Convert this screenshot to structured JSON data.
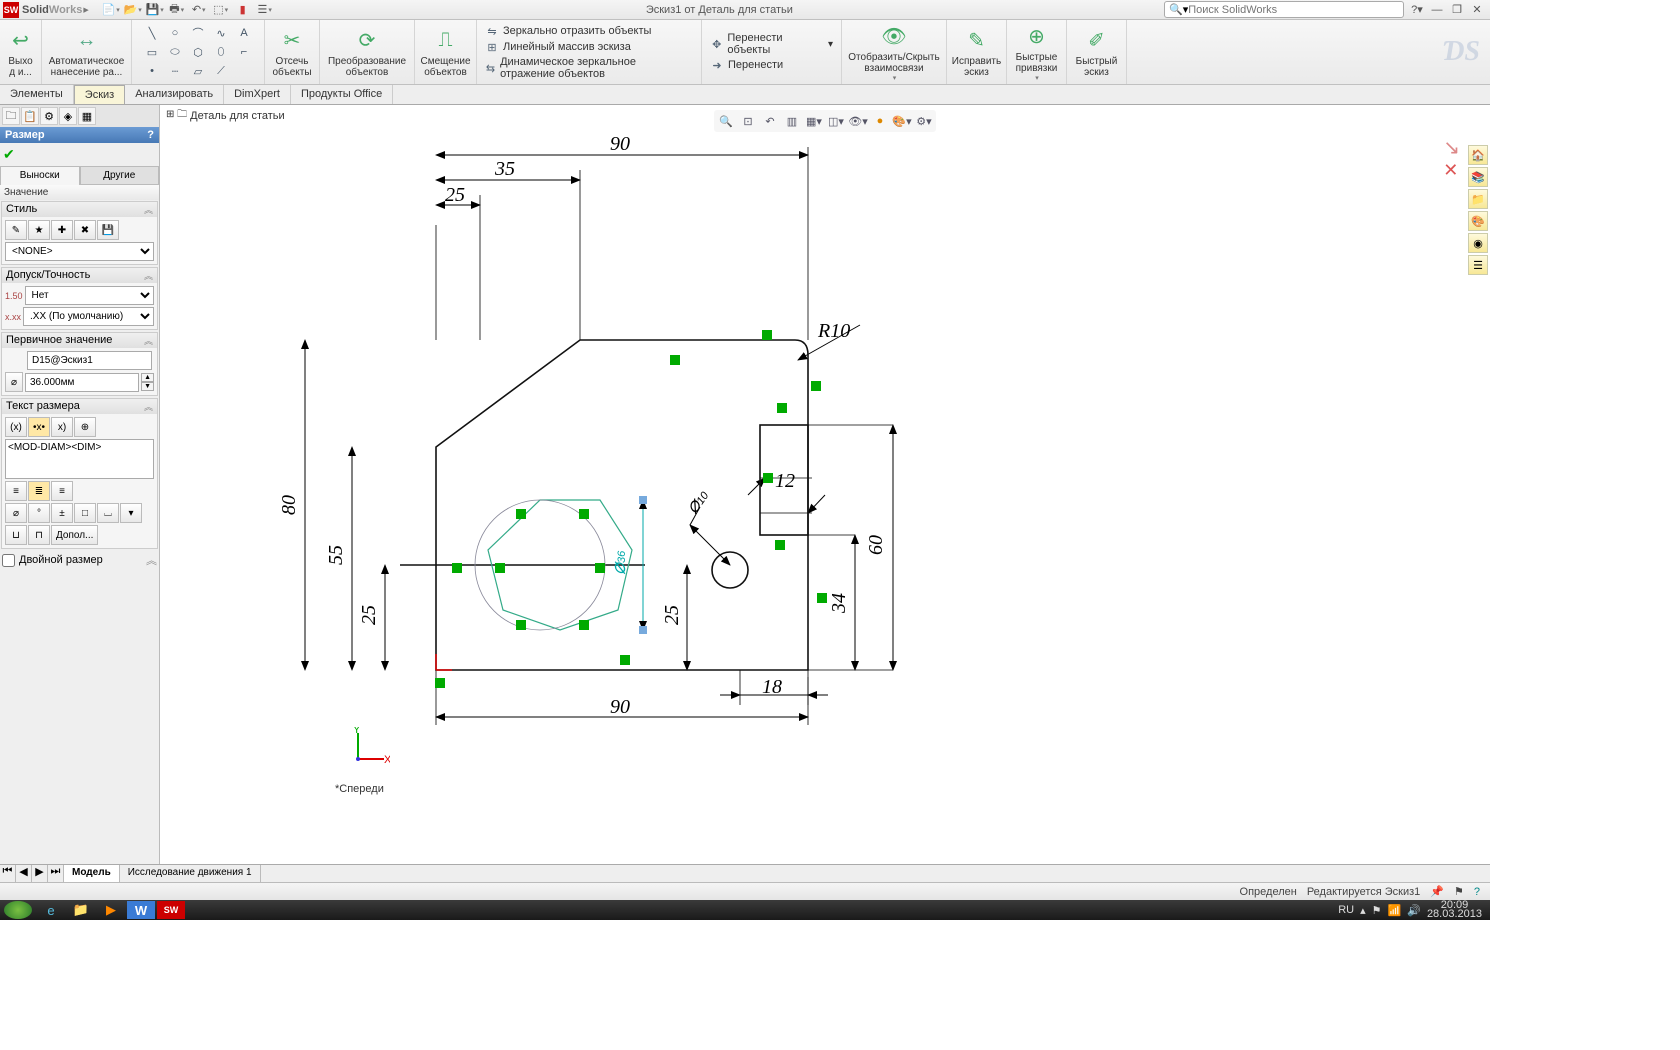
{
  "app": {
    "brand_bold": "Solid",
    "brand_light": "Works",
    "title": "Эскиз1 от Деталь для статьи",
    "search_placeholder": "Поиск SolidWorks"
  },
  "ribbon": {
    "exit": {
      "label": "Выхо\nд и..."
    },
    "autodim": {
      "label": "Автоматическое\nнанесение ра..."
    },
    "trim": {
      "label": "Отсечь\nобъекты"
    },
    "convert": {
      "label": "Преобразование\nобъектов"
    },
    "offset": {
      "label": "Смещение\nобъектов"
    },
    "mirror": "Зеркально отразить объекты",
    "linear": "Линейный массив эскиза",
    "dynmirror": "Динамическое зеркальное отражение объектов",
    "move": "Перенести объекты",
    "moveto": "Перенести",
    "showhide": {
      "label": "Отобразить/Скрыть\nвзаимосвязи"
    },
    "repair": {
      "label": "Исправить\nэскиз"
    },
    "snaps": {
      "label": "Быстрые\nпривязки"
    },
    "quick": {
      "label": "Быстрый\nэскиз"
    }
  },
  "tabs": [
    "Элементы",
    "Эскиз",
    "Анализировать",
    "DimXpert",
    "Продукты Office"
  ],
  "panel": {
    "header": "Размер",
    "subtabs": [
      "Выноски",
      "Другие"
    ],
    "value_title": "Значение",
    "style": {
      "hdr": "Стиль",
      "sel": "<NONE>"
    },
    "tol": {
      "hdr": "Допуск/Точность",
      "sel1": "Нет",
      "sel2": ".XX (По умолчанию)"
    },
    "prim": {
      "hdr": "Первичное значение",
      "name": "D15@Эскиз1",
      "val": "36.000мм"
    },
    "text": {
      "hdr": "Текст размера",
      "val": "<MOD-DIAM><DIM>"
    },
    "extra_btn": "Допол...",
    "dual": "Двойной размер"
  },
  "doc_tab": "Деталь для статьи",
  "dims": {
    "d90a": "90",
    "d35": "35",
    "d25a": "25",
    "d80": "80",
    "d55": "55",
    "d25b": "25",
    "d36": "36",
    "r10": "R10",
    "d12": "12",
    "d60": "60",
    "d34": "34",
    "d25c": "25",
    "d18": "18",
    "d90b": "90",
    "d10": "10"
  },
  "view_label": "*Спереди",
  "btm_tabs": [
    "Модель",
    "Исследование движения 1"
  ],
  "status": {
    "defined": "Определен",
    "editing": "Редактируется Эскиз1"
  },
  "tray": {
    "lang": "RU",
    "time": "20:09",
    "date": "28.03.2013"
  }
}
